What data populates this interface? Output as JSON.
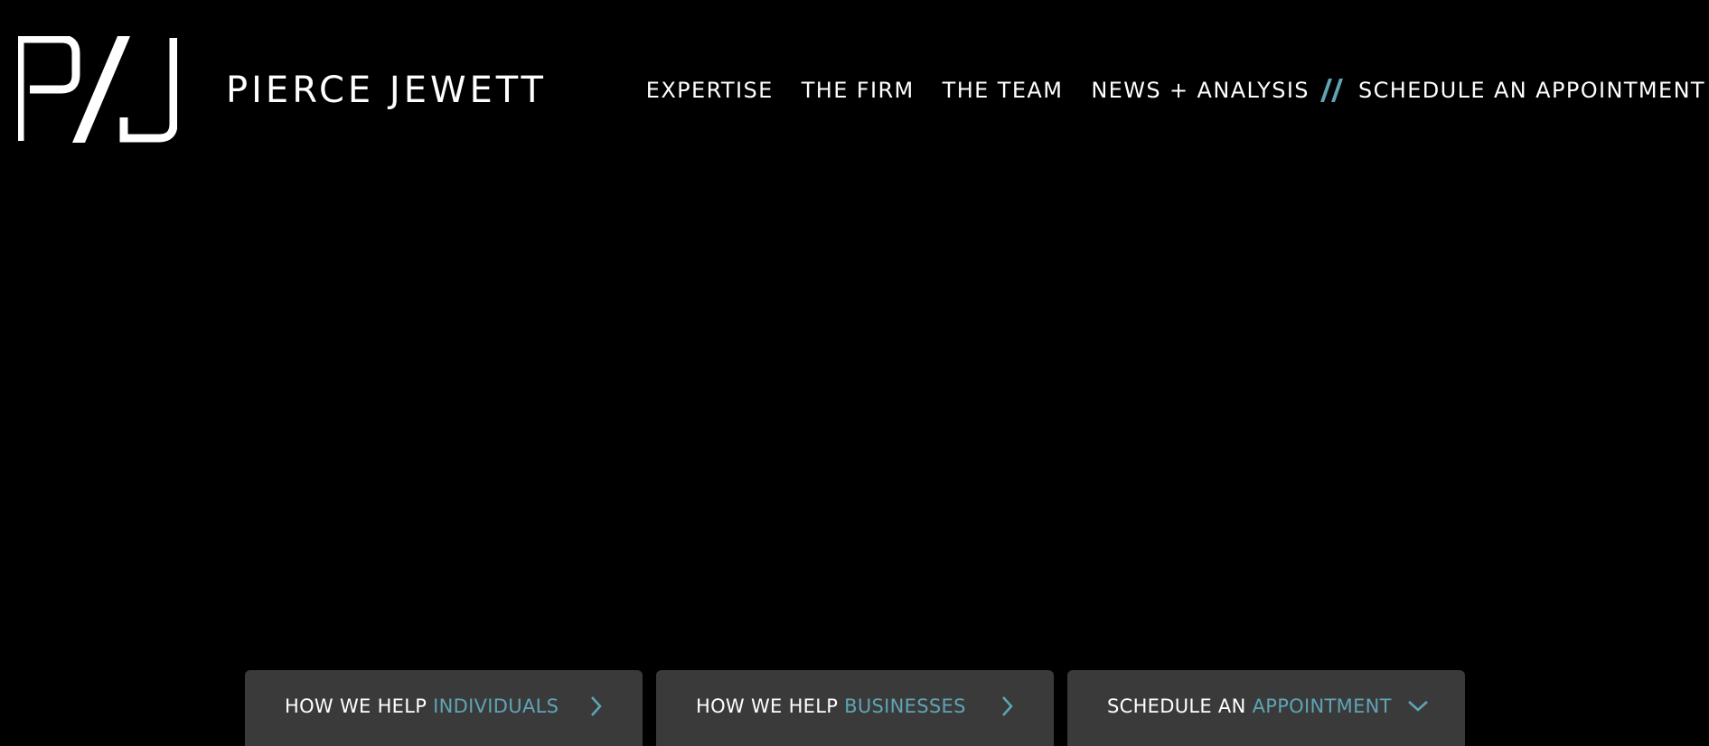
{
  "brand": {
    "name": "PIERCE JEWETT",
    "logo_icon": "pj-monogram-logo"
  },
  "nav": {
    "items": [
      {
        "label": "EXPERTISE"
      },
      {
        "label": "THE FIRM"
      },
      {
        "label": "THE TEAM"
      },
      {
        "label": "NEWS + ANALYSIS"
      }
    ],
    "separator_icon": "double-slash-icon",
    "cta_label": "SCHEDULE AN APPOINTMENT"
  },
  "cta_cards": [
    {
      "lead": "HOW WE HELP ",
      "accent": "INDIVIDUALS",
      "icon": "chevron-right-icon"
    },
    {
      "lead": "HOW WE HELP ",
      "accent": "BUSINESSES",
      "icon": "chevron-right-icon"
    },
    {
      "lead": "SCHEDULE AN ",
      "accent": "APPOINTMENT",
      "icon": "chevron-down-icon"
    }
  ],
  "colors": {
    "background": "#000000",
    "card": "#3a3a3a",
    "accent": "#5fa4b5",
    "text": "#ffffff"
  }
}
